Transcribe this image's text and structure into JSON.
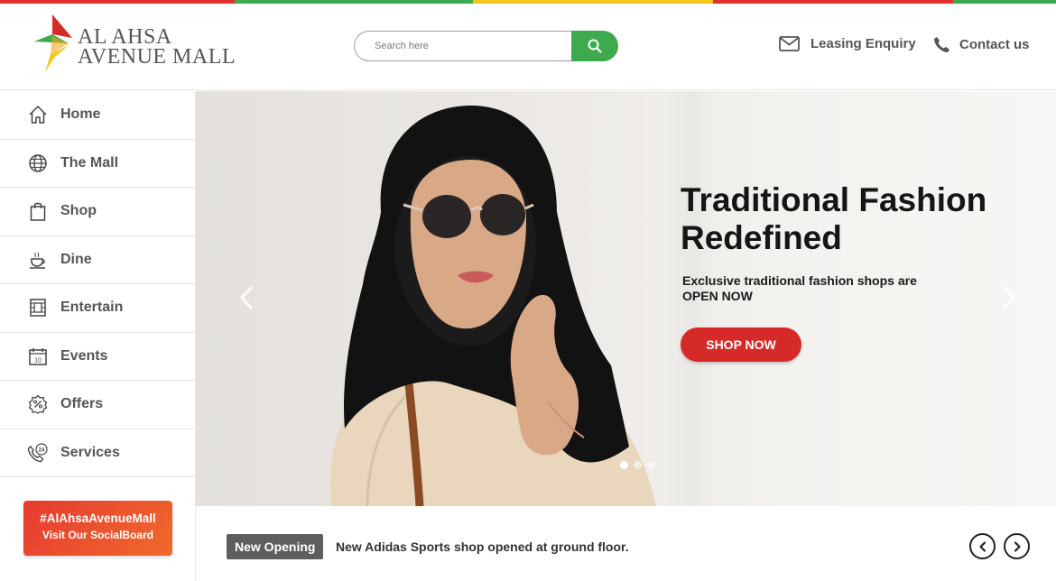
{
  "brand": {
    "line1": "AL AHSA",
    "line2": "AVENUE MALL",
    "stripe_colors": [
      "#e0312c",
      "#3daa4e",
      "#f5c51c",
      "#e0312c",
      "#3daa4e"
    ]
  },
  "search": {
    "placeholder": "Search here",
    "value": "",
    "icon": "search-icon",
    "button_color": "#3daa4e"
  },
  "header_links": [
    {
      "label": "Leasing Enquiry",
      "icon": "envelope-icon"
    },
    {
      "label": "Contact us",
      "icon": "phone-icon"
    }
  ],
  "sidebar": {
    "items": [
      {
        "label": "Home",
        "icon": "home-icon"
      },
      {
        "label": "The Mall",
        "icon": "globe-icon"
      },
      {
        "label": "Shop",
        "icon": "shopping-bag-icon"
      },
      {
        "label": "Dine",
        "icon": "coffee-cup-icon"
      },
      {
        "label": "Entertain",
        "icon": "film-icon"
      },
      {
        "label": "Events",
        "icon": "calendar-icon"
      },
      {
        "label": "Offers",
        "icon": "percent-badge-icon"
      },
      {
        "label": "Services",
        "icon": "24h-phone-icon"
      }
    ],
    "social": {
      "hashtag": "#AlAhsaAvenueMall",
      "cta": "Visit Our SocialBoard"
    }
  },
  "hero": {
    "title": "Traditional Fashion Redefined",
    "subtitle": "Exclusive traditional fashion shops are OPEN NOW",
    "button": "SHOP NOW",
    "button_color": "#d62a28",
    "slide_count": 3,
    "active_slide": 1
  },
  "ticker": {
    "badge": "New Opening",
    "message": "New Adidas Sports shop opened at ground floor."
  }
}
